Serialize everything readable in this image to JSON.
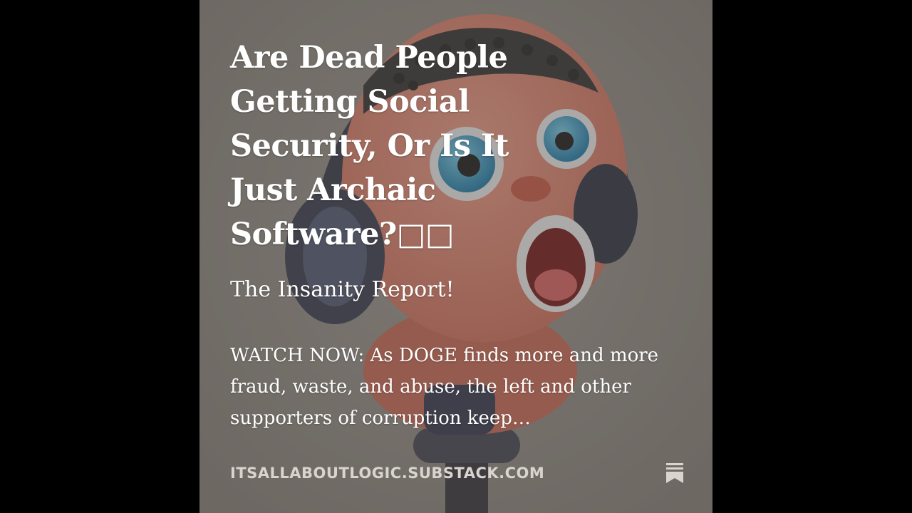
{
  "post": {
    "title": "Are Dead People Getting Social Security, Or Is It Just Archaic Software?□□",
    "subtitle": "The Insanity Report!",
    "excerpt": "WATCH NOW: As DOGE finds more and more fraud, waste, and abuse, the left and other supporters of corruption keep…",
    "domain": "ITSALLABOUTLOGIC.SUBSTACK.COM"
  },
  "icons": {
    "publisher": "substack-bookmark-icon",
    "illustration": "cartoon-character-at-microphone-illustration"
  },
  "colors": {
    "page_background": "#000000",
    "card_background": "#8f8a84",
    "text": "#ffffff",
    "domain_text": "#d9d4ce"
  }
}
